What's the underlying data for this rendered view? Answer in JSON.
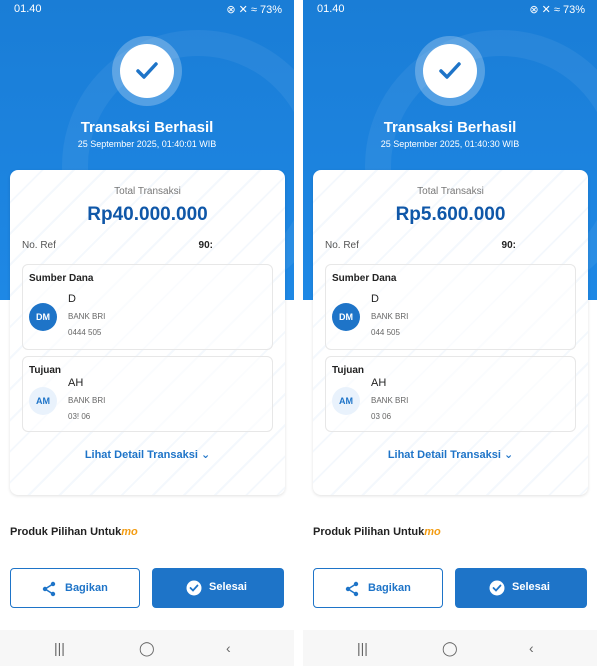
{
  "screens": [
    {
      "status_time": "01.40",
      "status_right": "⊗ ✕ ≈ 73%",
      "title": "Transaksi Berhasil",
      "datetime": "25 September 2025, 01:40:01 WIB",
      "total_label": "Total Transaksi",
      "total_amount": "Rp40.000.000",
      "ref_label": "No. Ref",
      "ref_value": "90:",
      "source_heading": "Sumber Dana",
      "source_initials": "DM",
      "source_name": "D",
      "source_bank": "BANK BRI",
      "source_number": "0444                505",
      "dest_heading": "Tujuan",
      "dest_initials": "AM",
      "dest_name": "AH",
      "dest_bank": "BANK BRI",
      "dest_number": "03!                   06",
      "detail_link": "Lihat Detail Transaksi ⌄",
      "produk_label": "Produk Pilihan Untuk",
      "produk_suffix": "mo",
      "share_label": "Bagikan",
      "done_label": "Selesai"
    },
    {
      "status_time": "01.40",
      "status_right": "⊗ ✕ ≈ 73%",
      "title": "Transaksi Berhasil",
      "datetime": "25 September 2025, 01:40:30 WIB",
      "total_label": "Total Transaksi",
      "total_amount": "Rp5.600.000",
      "ref_label": "No. Ref",
      "ref_value": "90:",
      "source_heading": "Sumber Dana",
      "source_initials": "DM",
      "source_name": "D",
      "source_bank": "BANK BRI",
      "source_number": "044                 505",
      "dest_heading": "Tujuan",
      "dest_initials": "AM",
      "dest_name": "AH",
      "dest_bank": "BANK BRI",
      "dest_number": "03                    06",
      "detail_link": "Lihat Detail Transaksi ⌄",
      "produk_label": "Produk Pilihan Untuk",
      "produk_suffix": "mo",
      "share_label": "Bagikan",
      "done_label": "Selesai"
    }
  ],
  "colors": {
    "brand_blue": "#1e74c8",
    "header_blue": "#1e88e5",
    "amount_blue": "#0f57a8",
    "accent_orange": "#f39c12"
  },
  "icons": {
    "check": "check-icon",
    "share": "share-icon",
    "done": "check-circle-icon",
    "nav_recent": "recent-apps-icon",
    "nav_home": "home-icon",
    "nav_back": "back-icon"
  }
}
